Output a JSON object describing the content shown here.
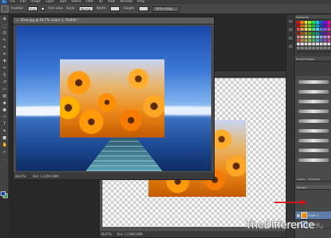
{
  "menubar": {
    "logo": "Ps",
    "items": [
      "File",
      "Edit",
      "Image",
      "Layer",
      "Type",
      "Select",
      "Filter",
      "3D",
      "View",
      "Window",
      "Help"
    ]
  },
  "options": {
    "feather_label": "Feather:",
    "feather_value": "0 px",
    "antialias_label": "Anti-alias",
    "style_label": "Style:",
    "style_value": "Normal",
    "width_label": "Width:",
    "height_label": "Height:",
    "refine_edge_label": "Refine Edge..."
  },
  "doc1": {
    "tab_title": "Dock.jpg @ 66,7% (Layer 1, RGB/8) *",
    "zoom": "66,67%",
    "doc_size": "Doc: 1,15M/1,60M"
  },
  "doc2": {
    "zoom": "66,67%",
    "doc_size": "Doc: 1,15M/1,60M"
  },
  "panels": {
    "swatches_tab": "Swatches",
    "brush_presets_tab": "Brush Presets",
    "layers_tab": "Layers",
    "channels_tab": "Channels",
    "blend_mode": "Normal",
    "layers": [
      {
        "name": "Layer 1"
      },
      {
        "name": "Layer 0"
      }
    ]
  },
  "colors": {
    "foreground": "#1c49c2",
    "background": "#1fa12c",
    "annotation_arrow": "#e01010"
  },
  "watermark": {
    "brand": "TheDifference",
    "suffix": ".ru"
  }
}
